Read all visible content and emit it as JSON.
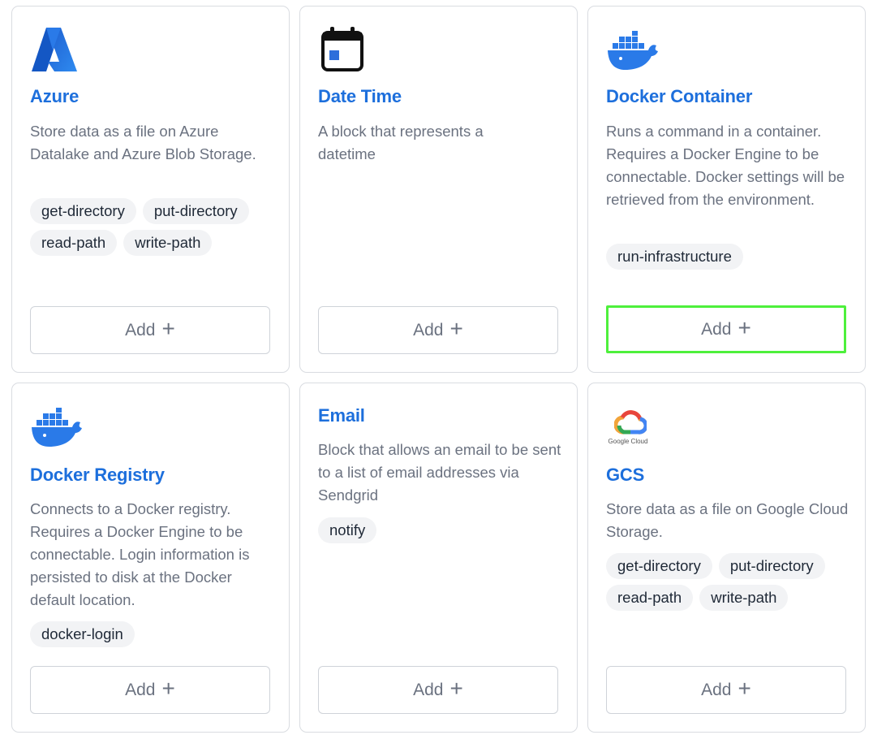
{
  "cards": [
    {
      "title": "Azure",
      "icon": "azure-logo-icon",
      "description": "Store data as a file on Azure Datalake and Azure Blob Storage.",
      "tags": [
        "get-directory",
        "put-directory",
        "read-path",
        "write-path"
      ],
      "add_label": "Add"
    },
    {
      "title": "Date Time",
      "icon": "calendar-icon",
      "description": "A block that represents a datetime",
      "tags": [],
      "add_label": "Add"
    },
    {
      "title": "Docker Container",
      "icon": "docker-logo-icon",
      "description": "Runs a command in a container. Requires a Docker Engine to be connectable. Docker settings will be retrieved from the environment.",
      "tags": [
        "run-infrastructure"
      ],
      "add_label": "Add"
    },
    {
      "title": "Docker Registry",
      "icon": "docker-logo-icon",
      "description": "Connects to a Docker registry. Requires a Docker Engine to be connectable. Login information is persisted to disk at the Docker default location.",
      "tags": [
        "docker-login"
      ],
      "add_label": "Add"
    },
    {
      "title": "Email",
      "icon": "",
      "description": "Block that allows an email to be sent to a list of email addresses via Sendgrid",
      "tags": [
        "notify"
      ],
      "add_label": "Add"
    },
    {
      "title": "GCS",
      "icon": "google-cloud-logo-icon",
      "logo_text": "Google Cloud",
      "description": "Store data as a file on Google Cloud Storage.",
      "tags": [
        "get-directory",
        "put-directory",
        "read-path",
        "write-path"
      ],
      "add_label": "Add"
    }
  ],
  "colors": {
    "title": "#1d6fdc",
    "highlight": "#4ef03c"
  }
}
